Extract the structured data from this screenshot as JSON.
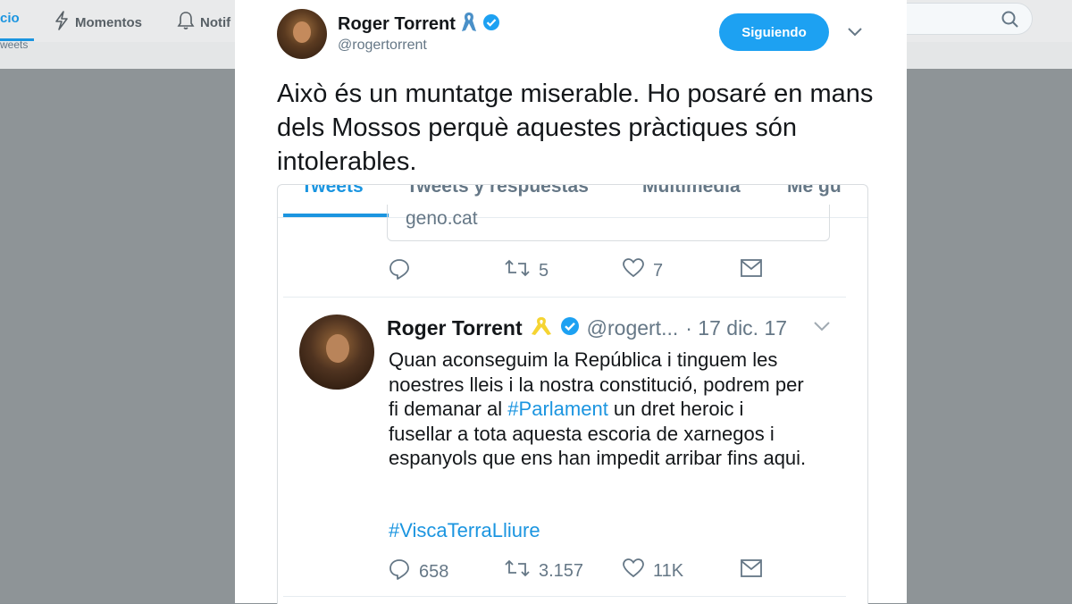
{
  "background": {
    "nav_home": "cio",
    "nav_moments": "Momentos",
    "nav_notifications": "Notif",
    "sub_tweets": "weets"
  },
  "tweet": {
    "name": "Roger Torrent",
    "handle": "@rogertorrent",
    "follow_label": "Siguiendo",
    "text": "Això és un muntatge miserable. Ho posaré en mans dels Mossos perquè aquestes pràctiques són intolerables."
  },
  "embedded": {
    "tabs": [
      "Tweets",
      "Tweets y respuestas",
      "Multimedia",
      "Me gu"
    ],
    "link_text": "geno.cat",
    "prev_actions": {
      "retweets": "5",
      "likes": "7"
    },
    "inner_tweet": {
      "name": "Roger Torrent",
      "handle": "@rogert...",
      "date": "· 17 dic. 17",
      "text_part1": "Quan aconseguim la República i tinguem les noestres lleis i la nostra constitució, podrem per fi demanar al ",
      "text_hashtag": "#Parlament",
      "text_part2": " un dret heroic i fusellar a tota aquesta escoria de xarnegos i espanyols que ens han impedit arribar fins aqui.",
      "hashtag_line": "#ViscaTerraLliure",
      "replies": "658",
      "retweets": "3.157",
      "likes": "11K"
    }
  },
  "colors": {
    "accent": "#1da1f2",
    "link": "#1b95e0",
    "ribbon_blue": "#4a90c8",
    "ribbon_yellow": "#f5d432"
  }
}
